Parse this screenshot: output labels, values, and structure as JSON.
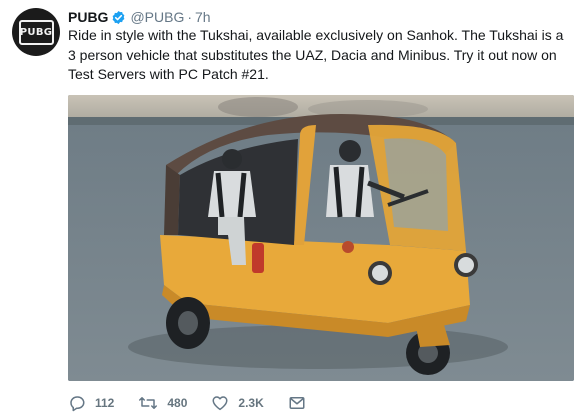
{
  "tweet": {
    "author_name": "PUBG",
    "handle": "@PUBG",
    "separator": "·",
    "time": "7h",
    "avatar_text": "PUBG",
    "text": "Ride in style with the Tukshai, available exclusively on Sanhok. The Tukshai is a 3 person vehicle that substitutes the UAZ, Dacia and Minibus. Try it out now on Test Servers with PC Patch #21.",
    "media_icon": "tukshai-vehicle-image"
  },
  "actions": {
    "replies": "112",
    "retweets": "480",
    "likes": "2.3K"
  },
  "colors": {
    "verified": "#1da1f2",
    "vehicle_yellow": "#e8a93a",
    "meta_text": "#657786"
  }
}
